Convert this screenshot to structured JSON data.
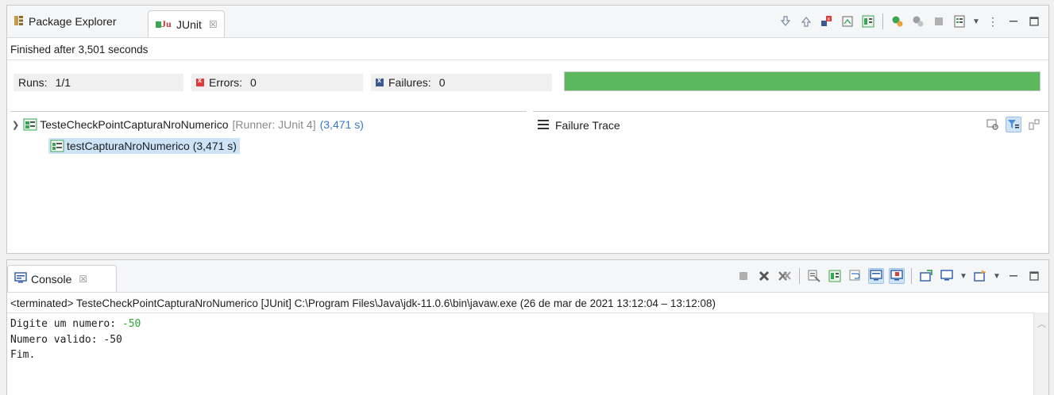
{
  "junit_panel": {
    "tabs": [
      {
        "label": "Package Explorer",
        "icon": "package-explorer-icon"
      },
      {
        "label": "JUnit",
        "icon": "junit-icon",
        "close": "☒"
      }
    ],
    "status": "Finished after 3,501 seconds",
    "runs_label": "Runs:",
    "runs_value": "1/1",
    "errors_label": "Errors:",
    "errors_value": "0",
    "failures_label": "Failures:",
    "failures_value": "0",
    "progress": 1.0,
    "progress_color": "#5cb85c",
    "tree": {
      "suite_name": "TesteCheckPointCapturaNroNumerico",
      "suite_runner": "[Runner: JUnit 4]",
      "suite_time": "(3,471 s)",
      "test_label": "testCapturaNroNumerico (3,471 s)"
    },
    "failure_trace_label": "Failure Trace"
  },
  "console_panel": {
    "tab_label": "Console",
    "tab_close": "☒",
    "terminated_line": "<terminated> TesteCheckPointCapturaNroNumerico [JUnit] C:\\Program Files\\Java\\jdk-11.0.6\\bin\\javaw.exe  (26 de mar de 2021 13:12:04 – 13:12:08)",
    "output": {
      "line1_prefix": "Digite um numero: ",
      "line1_input": "-50",
      "line2": "Numero valido: -50",
      "line3": "Fim."
    }
  },
  "colors": {
    "input_text": "#2ca62c",
    "selection": "#cde3f8",
    "link_blue": "#3779c7"
  }
}
